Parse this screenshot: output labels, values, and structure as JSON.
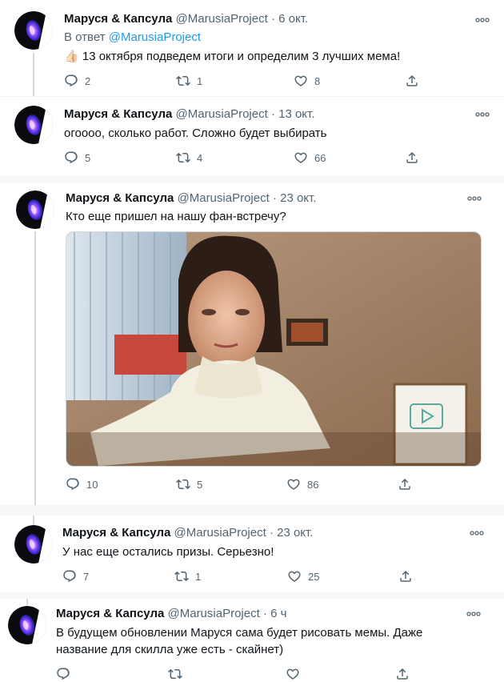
{
  "tweets": [
    {
      "author": "Маруся & Капсула",
      "handle": "@MarusiaProject",
      "time": "6 окт.",
      "reply_prefix": "В ответ",
      "reply_mention": "@MarusiaProject",
      "emoji": "👍🏻",
      "text": "13 октября подведем итоги и определим 3 лучших мема!",
      "replies": "2",
      "retweets": "1",
      "likes": "8"
    },
    {
      "author": "Маруся & Капсула",
      "handle": "@MarusiaProject",
      "time": "13 окт.",
      "text": "огоооо, сколько работ. Сложно будет выбирать",
      "replies": "5",
      "retweets": "4",
      "likes": "66"
    },
    {
      "author": "Маруся & Капсула",
      "handle": "@MarusiaProject",
      "time": "23 окт.",
      "text": "Кто еще пришел на нашу фан-встречу?",
      "replies": "10",
      "retweets": "5",
      "likes": "86"
    },
    {
      "author": "Маруся & Капсула",
      "handle": "@MarusiaProject",
      "time": "23 окт.",
      "text": "У нас еще остались призы. Серьезно!",
      "replies": "7",
      "retweets": "1",
      "likes": "25"
    },
    {
      "author": "Маруся & Капсула",
      "handle": "@MarusiaProject",
      "time": "6 ч",
      "text": "В будущем обновлении Маруся сама будет рисовать мемы. Даже название для скилла уже есть - скайнет)"
    }
  ],
  "colors": {
    "text": "#0f1419",
    "secondary": "#536471",
    "link": "#1d9bf0"
  },
  "icons": [
    "reply-icon",
    "retweet-icon",
    "like-icon",
    "share-icon",
    "more-icon"
  ]
}
